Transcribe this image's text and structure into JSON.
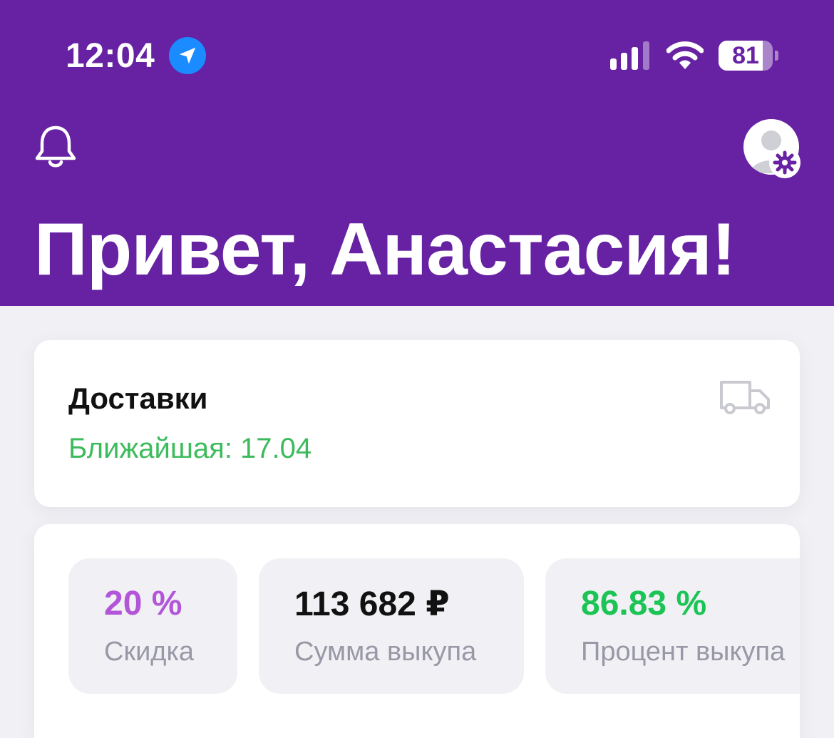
{
  "status_bar": {
    "time": "12:04",
    "battery": "81"
  },
  "header": {
    "greeting": "Привет, Анастасия!"
  },
  "delivery": {
    "title": "Доставки",
    "subtitle": "Ближайшая: 17.04"
  },
  "stats": [
    {
      "value": "20 %",
      "label": "Скидка",
      "color": "#b255d9"
    },
    {
      "value": "113 682 ₽",
      "label": "Сумма выкупа",
      "color": "#111111"
    },
    {
      "value": "86.83 %",
      "label": "Процент выкупа",
      "color": "#1cc455"
    }
  ],
  "colors": {
    "brand": "#6622a2",
    "accent_green": "#3dbb5c",
    "page_bg": "#f1f1f5"
  },
  "icons": [
    "location-arrow-icon",
    "signal-icon",
    "wifi-icon",
    "battery-icon",
    "bell-icon",
    "avatar-icon",
    "gear-icon",
    "truck-icon"
  ]
}
